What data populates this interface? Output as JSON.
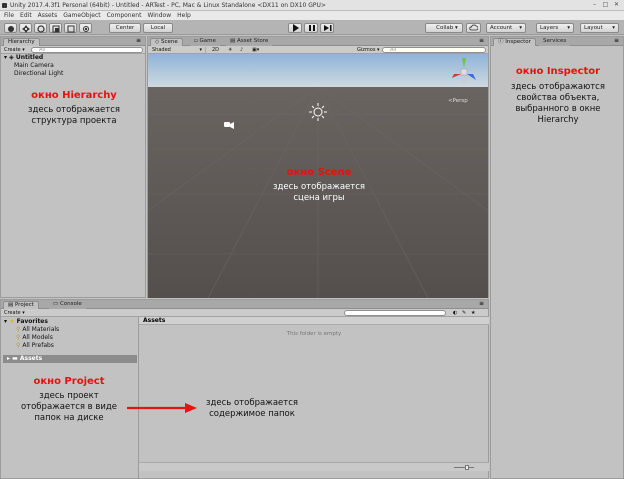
{
  "window": {
    "title": "Unity 2017.4.3f1 Personal (64bit) - Untitled - ARTest - PC, Mac & Linux Standalone <DX11 on DX10 GPU>"
  },
  "menu": [
    "File",
    "Edit",
    "Assets",
    "GameObject",
    "Component",
    "Window",
    "Help"
  ],
  "toolbar": {
    "center": "Center",
    "local": "Local",
    "collab": "Collab",
    "account": "Account",
    "layers": "Layers",
    "layout": "Layout"
  },
  "hierarchy": {
    "tab": "Hierarchy",
    "create": "Create",
    "search": "All",
    "scene": "Untitled",
    "items": [
      "Main Camera",
      "Directional Light"
    ]
  },
  "scene": {
    "tabs": [
      "Scene",
      "Game",
      "Asset Store"
    ],
    "shaded": "Shaded",
    "mode2d": "2D",
    "gizmos": "Gizmos",
    "search": "All",
    "persp": "Persp"
  },
  "inspector": {
    "tabs": [
      "Inspector",
      "Services"
    ]
  },
  "project": {
    "tabs": [
      "Project",
      "Console"
    ],
    "create": "Create",
    "favorites": "Favorites",
    "fav_items": [
      "All Materials",
      "All Models",
      "All Prefabs"
    ],
    "assets": "Assets",
    "assets_header": "Assets",
    "empty": "This folder is empty"
  },
  "annotations": {
    "hierarchy": {
      "title": "окно Hierarchy",
      "lines": [
        "здесь отображается",
        "структура проекта"
      ]
    },
    "scene": {
      "title": "окно Scene",
      "lines": [
        "здесь отображается",
        "сцена игры"
      ]
    },
    "inspector": {
      "title": "окно Inspector",
      "lines": [
        "здесь отображаются",
        "свойства объекта,",
        "выбранного в окне",
        "Hierarchy"
      ]
    },
    "project": {
      "title": "окно Project",
      "lines": [
        "здесь проект",
        "отображается в виде",
        "папок на диске"
      ]
    },
    "assets": {
      "lines": [
        "здесь отображается",
        "содержимое папок"
      ]
    }
  },
  "colors": {
    "annotation_title": "#e8110f",
    "sky": "#b9cde0",
    "ground": "#5b5653",
    "arrow": "#e31512"
  }
}
